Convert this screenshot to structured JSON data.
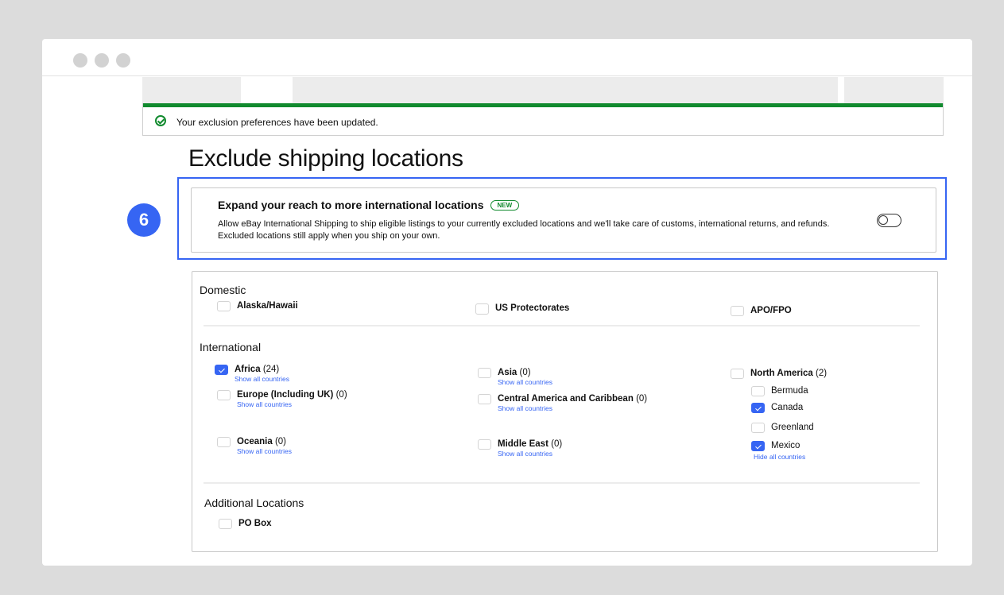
{
  "banner": {
    "message": "Your exclusion preferences have been updated."
  },
  "page": {
    "title": "Exclude shipping locations",
    "step_number": "6"
  },
  "promo": {
    "title": "Expand your reach to more international locations",
    "badge": "NEW",
    "description": "Allow eBay International Shipping to ship eligible listings to your currently excluded locations and we'll take care of customs, international returns, and refunds. Excluded locations still apply when you ship on your own.",
    "toggle_on": false
  },
  "domestic": {
    "title": "Domestic",
    "items": [
      {
        "label": "Alaska/Hawaii",
        "checked": false
      },
      {
        "label": "US Protectorates",
        "checked": false
      },
      {
        "label": "APO/FPO",
        "checked": false
      }
    ]
  },
  "international": {
    "title": "International",
    "regions": [
      {
        "label": "Africa",
        "count": "(24)",
        "checked": true,
        "link": "Show all countries"
      },
      {
        "label": "Europe (Including UK)",
        "count": "(0)",
        "checked": false,
        "link": "Show all countries"
      },
      {
        "label": "Oceania",
        "count": "(0)",
        "checked": false,
        "link": "Show all countries"
      },
      {
        "label": "Asia",
        "count": "(0)",
        "checked": false,
        "link": "Show all countries"
      },
      {
        "label": "Central America and Caribbean",
        "count": "(0)",
        "checked": false,
        "link": "Show all countries"
      },
      {
        "label": "Middle East",
        "count": "(0)",
        "checked": false,
        "link": "Show all countries"
      },
      {
        "label": "North America",
        "count": "(2)",
        "checked": false,
        "link": "Hide all countries"
      }
    ],
    "north_america_countries": [
      {
        "label": "Bermuda",
        "checked": false
      },
      {
        "label": "Canada",
        "checked": true
      },
      {
        "label": "Greenland",
        "checked": false
      },
      {
        "label": "Mexico",
        "checked": true
      }
    ]
  },
  "additional": {
    "title": "Additional Locations",
    "items": [
      {
        "label": "PO Box",
        "checked": false
      }
    ]
  },
  "colors": {
    "accent": "#3665f3",
    "success": "#118a2e"
  }
}
